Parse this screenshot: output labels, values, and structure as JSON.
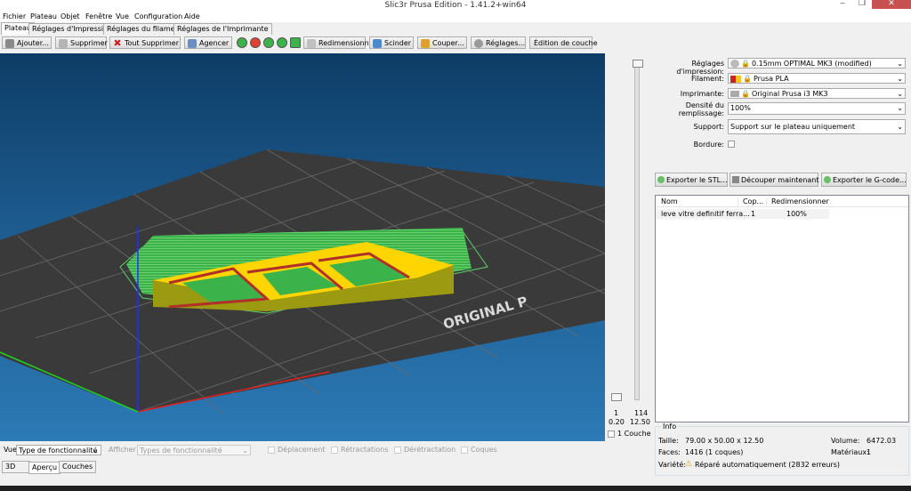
{
  "window": {
    "title": "Slic3r Prusa Edition - 1.41.2+win64"
  },
  "menu": [
    "Fichier",
    "Plateau",
    "Objet",
    "Fenêtre",
    "Vue",
    "Configuration",
    "Aide"
  ],
  "tabs": [
    "Plateau",
    "Réglages d'Impression",
    "Réglages du filament",
    "Réglages de l'Imprimante"
  ],
  "toolbar": {
    "add": "Ajouter...",
    "delete": "Supprimer",
    "delete_all": "Tout Supprimer",
    "arrange": "Agencer",
    "resize": "Redimensionner...",
    "split": "Scinder",
    "cut": "Couper...",
    "settings": "Réglages...",
    "layer_edit": "Édition de couche"
  },
  "viewport": {
    "bed_label": "ORIGINAL P"
  },
  "layer_slider": {
    "bottom_layer": "1",
    "top_layer": "114",
    "bottom_height": "0.20",
    "top_height": "12.50",
    "one_layer_label": "1 Couche"
  },
  "settings": {
    "print_label": "Réglages d'impression:",
    "print_value": "0.15mm OPTIMAL MK3 (modified)",
    "filament_label": "Filament:",
    "filament_value": "Prusa PLA",
    "printer_label": "Imprimante:",
    "printer_value": "Original Prusa i3 MK3",
    "infill_label_1": "Densité du",
    "infill_label_2": "remplissage:",
    "infill_value": "100%",
    "support_label": "Support:",
    "support_value": "Support sur le plateau uniquement",
    "brim_label": "Bordure:"
  },
  "actions": {
    "export_stl": "Exporter le STL...",
    "slice_now": "Découper maintenant",
    "export_gcode": "Exporter le G-code..."
  },
  "object_list": {
    "headers": [
      "Nom",
      "Cop...",
      "Redimensionner"
    ],
    "rows": [
      {
        "name": "leve vitre definitif ferra...",
        "copies": "1",
        "scale": "100%"
      }
    ]
  },
  "info": {
    "title": "Info",
    "size_label": "Taille:",
    "size_value": "79.00 x 50.00 x 12.50",
    "volume_label": "Volume:",
    "volume_value": "6472.03",
    "faces_label": "Faces:",
    "faces_value": "1416 (1 coques)",
    "materials_label": "Matériaux:",
    "materials_value": "1",
    "manifold_label": "Variété:",
    "manifold_value": "Réparé automatiquement (2832 erreurs)"
  },
  "bottom": {
    "view_label": "Vue",
    "view_value": "Type de fonctionnalité",
    "show_label": "Afficher",
    "show_value": "Types de fonctionnalité",
    "travel": "Déplacement",
    "retractions": "Rétractations",
    "deretractions": "Dérétractation",
    "shells": "Coques",
    "tabs": [
      "3D",
      "Aperçu",
      "Couches"
    ]
  },
  "colors": {
    "accent": "#3c7fb1",
    "perimeter": "#ffd500",
    "infill": "#b03029",
    "support": "#3cb34a"
  }
}
